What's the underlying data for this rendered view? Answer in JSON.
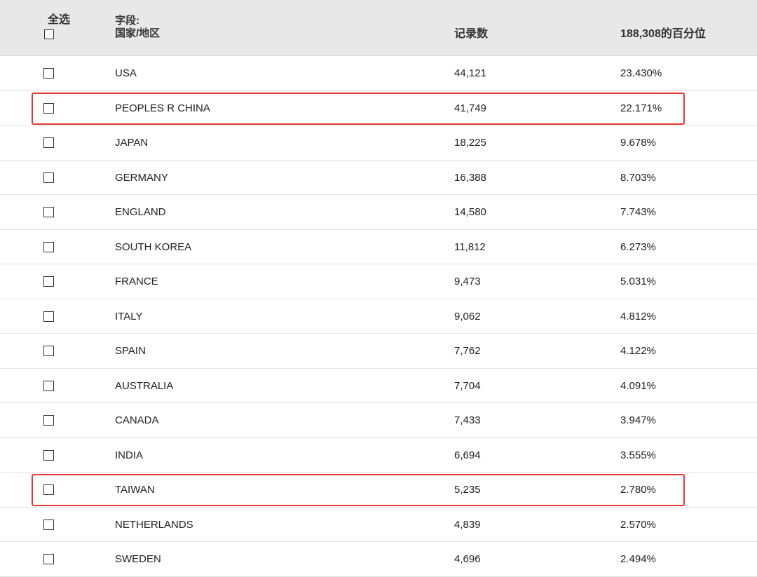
{
  "header": {
    "select_all_label": "全选",
    "field_label": "字段:",
    "field_name": "国家/地区",
    "count_label": "记录数",
    "percent_label": "188,308的百分位"
  },
  "rows": [
    {
      "country": "USA",
      "count": "44,121",
      "percent": "23.430%"
    },
    {
      "country": "PEOPLES R CHINA",
      "count": "41,749",
      "percent": "22.171%",
      "highlighted": true
    },
    {
      "country": "JAPAN",
      "count": "18,225",
      "percent": "9.678%"
    },
    {
      "country": "GERMANY",
      "count": "16,388",
      "percent": "8.703%"
    },
    {
      "country": "ENGLAND",
      "count": "14,580",
      "percent": "7.743%"
    },
    {
      "country": "SOUTH KOREA",
      "count": "11,812",
      "percent": "6.273%"
    },
    {
      "country": "FRANCE",
      "count": "9,473",
      "percent": "5.031%"
    },
    {
      "country": "ITALY",
      "count": "9,062",
      "percent": "4.812%"
    },
    {
      "country": "SPAIN",
      "count": "7,762",
      "percent": "4.122%"
    },
    {
      "country": "AUSTRALIA",
      "count": "7,704",
      "percent": "4.091%"
    },
    {
      "country": "CANADA",
      "count": "7,433",
      "percent": "3.947%"
    },
    {
      "country": "INDIA",
      "count": "6,694",
      "percent": "3.555%"
    },
    {
      "country": "TAIWAN",
      "count": "5,235",
      "percent": "2.780%",
      "highlighted": true
    },
    {
      "country": "NETHERLANDS",
      "count": "4,839",
      "percent": "2.570%"
    },
    {
      "country": "SWEDEN",
      "count": "4,696",
      "percent": "2.494%"
    }
  ],
  "colors": {
    "header_bg": "#e8e8e8",
    "highlight_border": "#e53935",
    "row_divider": "#e2e2e2"
  }
}
